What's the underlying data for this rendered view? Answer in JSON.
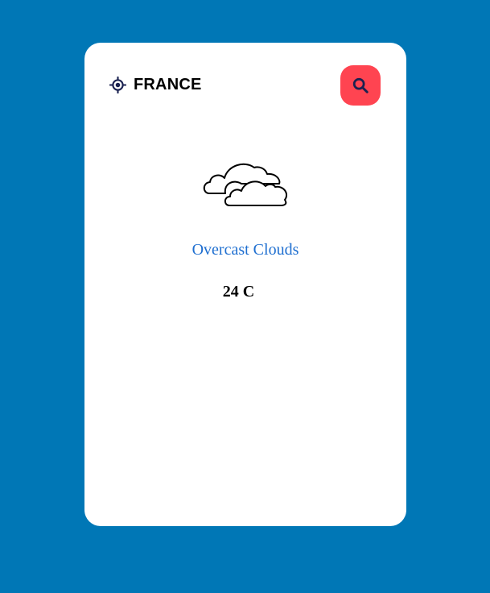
{
  "header": {
    "location_icon": "location-crosshair-icon",
    "country": "FRANCE",
    "search_icon": "search-icon"
  },
  "weather": {
    "icon": "overcast-clouds-icon",
    "description": "Overcast Clouds",
    "temperature": "24 C"
  },
  "colors": {
    "background": "#0077b6",
    "card": "#ffffff",
    "search_button": "#ff4451",
    "accent_text": "#1f6fd0",
    "icon_dark": "#1a2150"
  }
}
